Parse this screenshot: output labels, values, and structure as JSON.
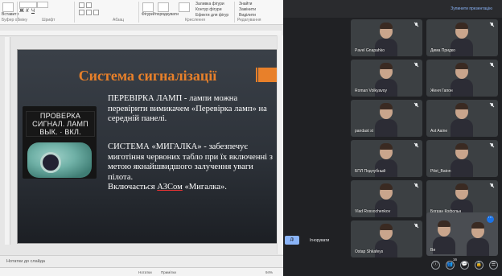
{
  "ppt": {
    "ribbon": {
      "font_name": "",
      "font_size": "",
      "bold": "Ж",
      "italic": "К",
      "underline": "Ч",
      "paste_label": "Вставити",
      "clipboard_group": "Буфер обміну",
      "slides_group": "Слайди",
      "font_group": "Шрифт",
      "paragraph_group": "Абзац",
      "drawing_group": "Креслення",
      "shapes_label": "Фігури",
      "arrange_label": "Упорядкувати",
      "styles_label": "Експрес-стилі",
      "fill_label": "Заливка фігури",
      "outline_label": "Контур фігури",
      "effects_label": "Ефекти для фігур",
      "find_label": "Знайти",
      "replace_label": "Замінити",
      "select_label": "Виділити",
      "editing_group": "Редагування"
    },
    "slide": {
      "title": "Система сигналізації",
      "photo_lines": [
        "ПРОВЕРКА",
        "СИГНАЛ. ЛАМП",
        "ВЫК.  ·  ВКЛ."
      ],
      "para1": "ПЕРЕВІРКА ЛАМП - лампи можна перевірити вимикачем «Перевірка ламп» на середній панелі.",
      "para2_a": "СИСТЕМА «МИГАЛКА» - забезпечує миготіння червоних табло при їх включенні з метою якнайшвидшого залучення уваги пілота.",
      "para2_b_pre": "Включається ",
      "para2_b_u": "АЗСом",
      "para2_b_post": " «Мигалка»."
    },
    "notes_placeholder": "Нотатки до слайда",
    "status": {
      "notes": "Нотатки",
      "comments": "Примітки",
      "zoom": "94%"
    }
  },
  "meet": {
    "present_link": "Зупинити презентацію",
    "present_button": "Ді",
    "ignore_label": "Ігнорувати",
    "participants": [
      {
        "name": "Pavel Gnapahko"
      },
      {
        "name": "Дима Придко"
      },
      {
        "name": "Roman Volkyavoy"
      },
      {
        "name": "Женя Гапон"
      },
      {
        "name": "pandast st"
      },
      {
        "name": "Ast Aaine"
      },
      {
        "name": "БПЛ Подлубный"
      },
      {
        "name": "Pilot_Baton"
      },
      {
        "name": "Vlad Rossochenkov"
      },
      {
        "name": "Богдан Кофольн"
      },
      {
        "name": "Ostap Shkafeys"
      },
      {
        "name": "Ви"
      }
    ],
    "self_count": "16",
    "controls": [
      "ⓘ",
      "👥",
      "💬",
      "🔒",
      "☰"
    ]
  }
}
